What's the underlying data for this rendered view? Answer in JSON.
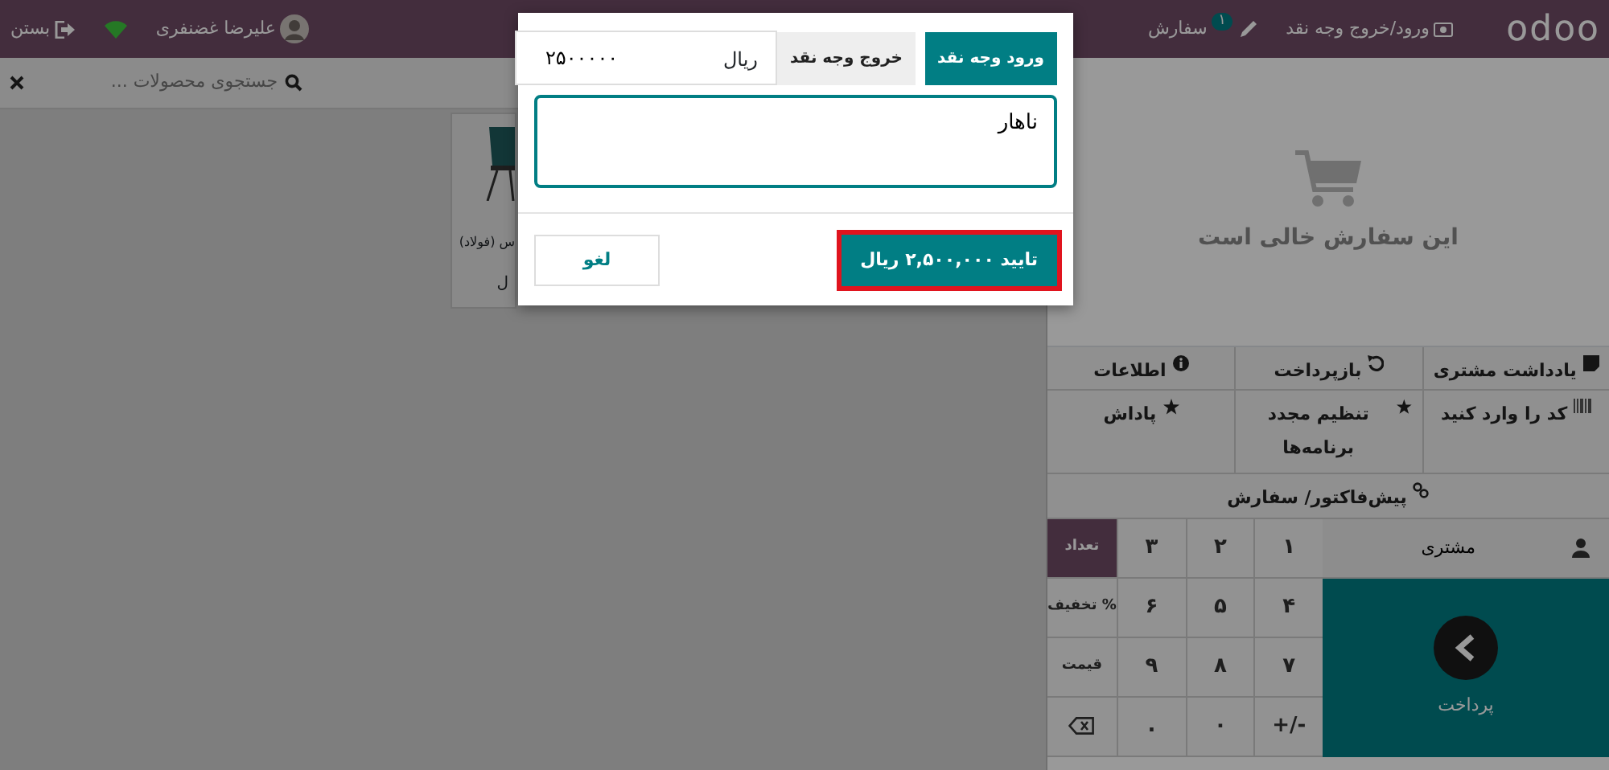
{
  "navbar": {
    "logo": "odoo",
    "cash_in_out": "ورود/خروج وجه نقد",
    "orders": {
      "label": "سفارش",
      "badge": "۱"
    },
    "user": "علیرضا غضنفری",
    "close": "بستن"
  },
  "search": {
    "placeholder": "جستجوی محصولات ..."
  },
  "product": {
    "name": "س (فولاد)",
    "price": "ل"
  },
  "order": {
    "empty_message": "این سفارش خالی است"
  },
  "actions": [
    {
      "label": "یادداشت مشتری"
    },
    {
      "label": "بازپرداخت"
    },
    {
      "label": "اطلاعات"
    },
    {
      "label": "کد را وارد کنید"
    },
    {
      "label": "تنظیم مجدد برنامه‌ها"
    },
    {
      "label": "پاداش"
    }
  ],
  "proforma": "پیش‌فاکتور/ سفارش",
  "customer": "مشتری",
  "payment": "پرداخت",
  "numpad": [
    {
      "kind": "digit",
      "label": "۱"
    },
    {
      "kind": "digit",
      "label": "۲"
    },
    {
      "kind": "digit",
      "label": "۳"
    },
    {
      "kind": "mode",
      "label": "تعداد",
      "selected": true
    },
    {
      "kind": "digit",
      "label": "۴"
    },
    {
      "kind": "digit",
      "label": "۵"
    },
    {
      "kind": "digit",
      "label": "۶"
    },
    {
      "kind": "mode",
      "label": "% تخفیف",
      "selected": false
    },
    {
      "kind": "digit",
      "label": "۷"
    },
    {
      "kind": "digit",
      "label": "۸"
    },
    {
      "kind": "digit",
      "label": "۹"
    },
    {
      "kind": "mode",
      "label": "قیمت",
      "selected": false
    },
    {
      "kind": "digit",
      "label": "-/+"
    },
    {
      "kind": "digit",
      "label": "۰"
    },
    {
      "kind": "digit",
      "label": "."
    },
    {
      "kind": "backspace"
    }
  ],
  "modal": {
    "tabs": [
      {
        "label": "ورود وجه نقد",
        "selected": true
      },
      {
        "label": "خروج وجه نقد",
        "selected": false
      }
    ],
    "amount": {
      "currency": "ریال",
      "value": "۲۵۰۰۰۰۰"
    },
    "reason": "ناهار",
    "confirm": {
      "label": "تایید ۲,۵۰۰,۰۰۰ ریال",
      "highlighted": true
    },
    "cancel": "لغو"
  }
}
